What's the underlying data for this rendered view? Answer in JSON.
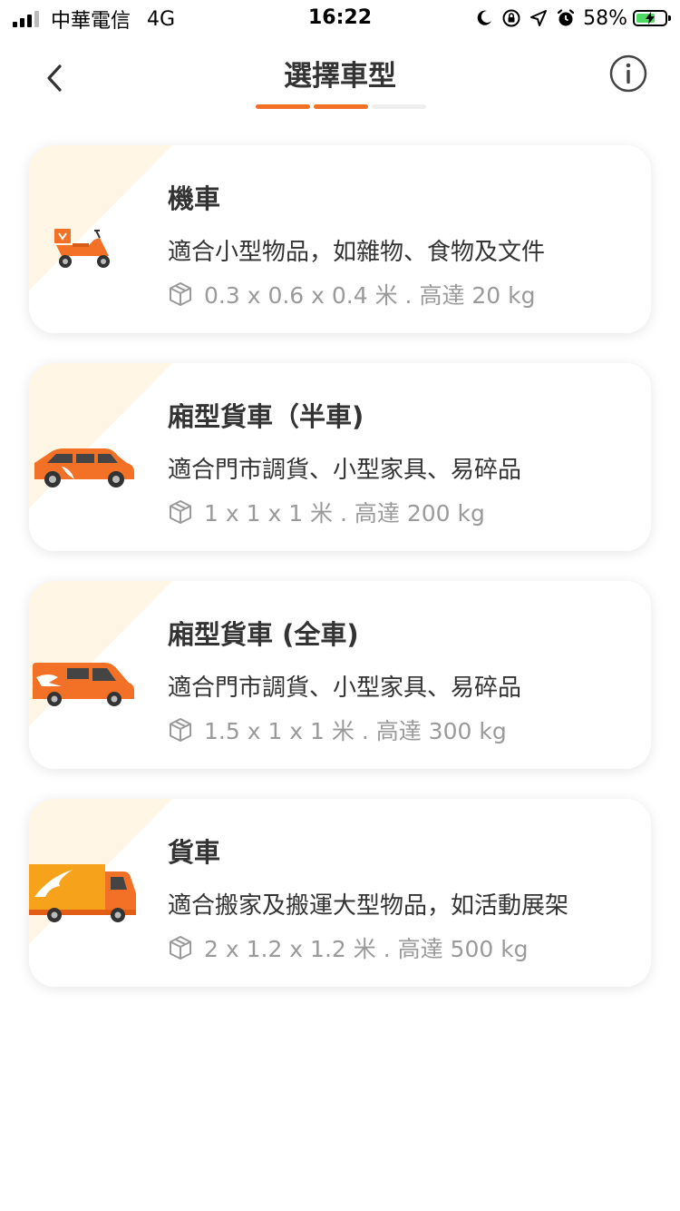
{
  "status_bar": {
    "carrier": "中華電信",
    "network": "4G",
    "time": "16:22",
    "battery_percent": "58%",
    "battery_level": 0.58
  },
  "header": {
    "title": "選擇車型",
    "progress_total_steps": 3,
    "progress_current_step": 2
  },
  "colors": {
    "accent": "#f27127",
    "card_triangle": "#fff6e6"
  },
  "vehicles": [
    {
      "name": "機車",
      "description": "適合小型物品，如雜物、食物及文件",
      "spec": "0.3 x 0.6 x 0.4 米 . 高達 20 kg",
      "icon": "motorcycle-icon"
    },
    {
      "name": "廂型貨車（半車)",
      "description": "適合門市調貨、小型家具、易碎品",
      "spec": "1 x 1 x 1 米 . 高達 200 kg",
      "icon": "suv-icon"
    },
    {
      "name": "廂型貨車 (全車)",
      "description": "適合門市調貨、小型家具、易碎品",
      "spec": "1.5 x 1 x 1 米 . 高達 300 kg",
      "icon": "van-icon"
    },
    {
      "name": "貨車",
      "description": "適合搬家及搬運大型物品，如活動展架",
      "spec": "2 x 1.2 x 1.2 米 . 高達 500 kg",
      "icon": "truck-icon"
    }
  ]
}
